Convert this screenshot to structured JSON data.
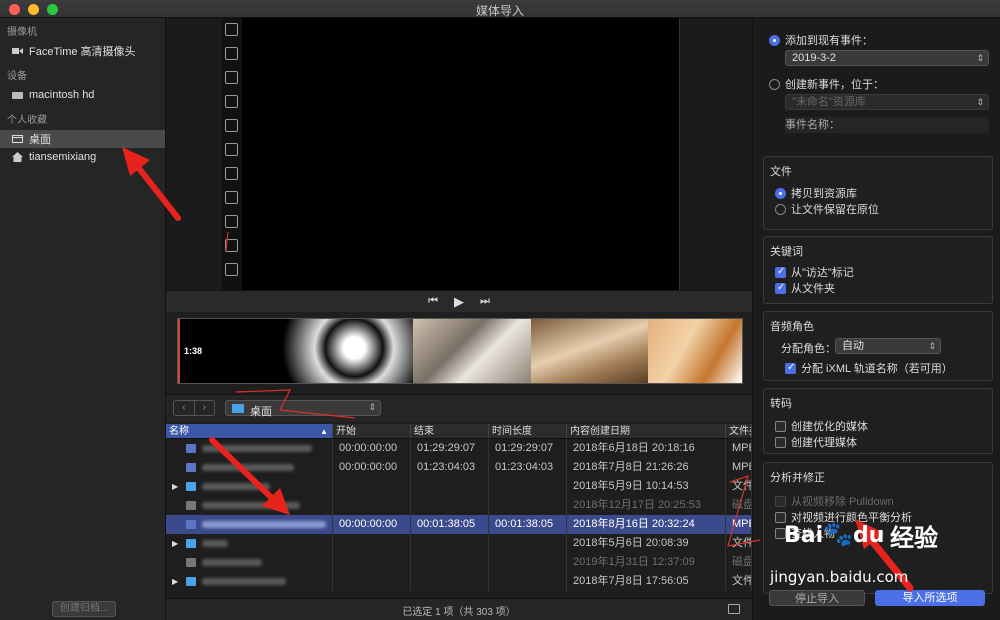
{
  "window": {
    "title": "媒体导入",
    "traffic_lights": [
      "#ff5f57",
      "#febc2e",
      "#28c840"
    ]
  },
  "sidebar": {
    "sections": [
      {
        "header": "摄像机",
        "items": [
          {
            "label": "FaceTime 高清摄像头",
            "icon": "camera-icon"
          }
        ]
      },
      {
        "header": "设备",
        "items": [
          {
            "label": "macintosh hd",
            "icon": "hard-drive-icon"
          }
        ]
      },
      {
        "header": "个人收藏",
        "items": [
          {
            "label": "桌面",
            "icon": "desktop-icon",
            "selected": true
          },
          {
            "label": "tiansemixiang",
            "icon": "home-icon"
          }
        ]
      }
    ],
    "create_archive_label": "创建归档..."
  },
  "viewer": {
    "transport": {
      "prev": "⏮",
      "play": "▶",
      "next": "⏭"
    }
  },
  "thumbnails": {
    "timecode": "1:38"
  },
  "browser": {
    "back": "‹",
    "forward": "›",
    "folder": "桌面"
  },
  "table": {
    "columns": [
      "名称",
      "开始",
      "结束",
      "时间长度",
      "内容创建日期",
      "文件类"
    ],
    "rows": [
      {
        "disclosure": "",
        "icon": "video",
        "start": "00:00:00:00",
        "end": "01:29:29:07",
        "duration": "01:29:29:07",
        "created": "2018年6月18日 20:18:16",
        "kind": "MPE",
        "selected": false,
        "dim": false
      },
      {
        "disclosure": "",
        "icon": "video",
        "start": "00:00:00:00",
        "end": "01:23:04:03",
        "duration": "01:23:04:03",
        "created": "2018年7月8日 21:26:26",
        "kind": "MPE",
        "selected": false,
        "dim": false
      },
      {
        "disclosure": "▶",
        "icon": "folder",
        "start": "",
        "end": "",
        "duration": "",
        "created": "2018年5月9日 10:14:53",
        "kind": "文件",
        "selected": false,
        "dim": false
      },
      {
        "disclosure": "",
        "icon": "disk",
        "start": "",
        "end": "",
        "duration": "",
        "created": "2018年12月17日 20:25:53",
        "kind": "磁盘",
        "selected": false,
        "dim": true
      },
      {
        "disclosure": "",
        "icon": "video",
        "start": "00:00:00:00",
        "end": "00:01:38:05",
        "duration": "00:01:38:05",
        "created": "2018年8月16日 20:32:24",
        "kind": "MPE",
        "selected": true,
        "dim": false
      },
      {
        "disclosure": "▶",
        "icon": "folder",
        "start": "",
        "end": "",
        "duration": "",
        "created": "2018年5月6日 20:08:39",
        "kind": "文件",
        "selected": false,
        "dim": false
      },
      {
        "disclosure": "",
        "icon": "disk",
        "start": "",
        "end": "",
        "duration": "",
        "created": "2019年1月31日 12:37:09",
        "kind": "磁盘",
        "selected": false,
        "dim": true
      },
      {
        "disclosure": "▶",
        "icon": "folder",
        "start": "",
        "end": "",
        "duration": "",
        "created": "2018年7月8日 17:56:05",
        "kind": "文件",
        "selected": false,
        "dim": false
      }
    ],
    "status": "已选定 1 项（共 303 项）"
  },
  "right_panel": {
    "add_existing_label": "添加到现有事件：",
    "existing_event": "2019-3-2",
    "create_new_label": "创建新事件，位于：",
    "library_name": "\"未命名\"资源库",
    "event_name_label": "事件名称：",
    "files": {
      "title": "文件",
      "copy_label": "拷贝到资源库",
      "leave_label": "让文件保留在原位"
    },
    "keywords": {
      "title": "关键词",
      "finder_tags_label": "从\"访达\"标记",
      "folders_label": "从文件夹"
    },
    "audio_roles": {
      "title": "音频角色",
      "assign_label": "分配角色：",
      "assign_value": "自动",
      "ixml_label": "分配 iXML 轨道名称（若可用）"
    },
    "transcode": {
      "title": "转码",
      "optimized_label": "创建优化的媒体",
      "proxy_label": "创建代理媒体"
    },
    "analyze": {
      "title": "分析并修正",
      "pulldown_label": "从视频移除 Pulldown",
      "color_balance_label": "对视频进行颜色平衡分析",
      "find_people_label": "查找人物"
    },
    "stop_import_label": "停止导入",
    "import_all_label": "导入所选项"
  },
  "watermark": {
    "brand": "Bai",
    "brand_suffix": "du",
    "product": "经验",
    "url": "jingyan.baidu.com"
  }
}
